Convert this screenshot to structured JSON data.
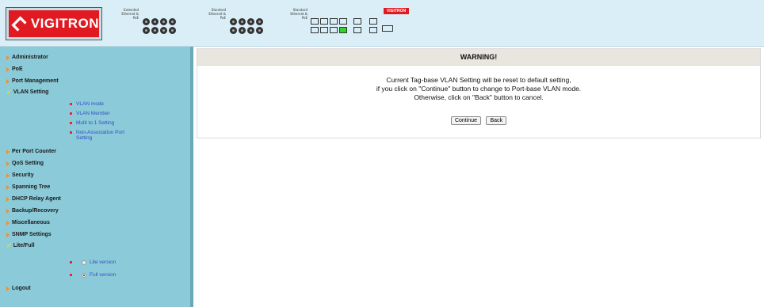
{
  "header": {
    "logo_text": "VIGITRON",
    "brand_mini": "VIGITRON",
    "panel_labels": [
      "Extended Ethernet & PoE",
      "Standard Ethernet & PoE",
      "Standard Ethernet & PoE"
    ]
  },
  "sidebar": {
    "items": [
      {
        "label": "Administrator"
      },
      {
        "label": "PoE"
      },
      {
        "label": "Port Management"
      },
      {
        "label": "VLAN Setting"
      },
      {
        "label": "Per Port Counter"
      },
      {
        "label": "QoS Setting"
      },
      {
        "label": "Security"
      },
      {
        "label": "Spanning Tree"
      },
      {
        "label": "DHCP Relay Agent"
      },
      {
        "label": "Backup/Recovery"
      },
      {
        "label": "Miscellaneous"
      },
      {
        "label": "SNMP Settings"
      },
      {
        "label": "Lite/Full"
      },
      {
        "label": "Logout"
      }
    ],
    "vlan_sub": [
      "VLAN mode",
      "VLAN Member",
      "Multi to 1 Setting",
      "Non-Association Port Setting"
    ],
    "lite_full": {
      "lite_label": "Lite version",
      "full_label": "Full version",
      "selected": "Full version"
    }
  },
  "main": {
    "title": "WARNING!",
    "line1": "Current Tag-base VLAN Setting will be reset to default setting,",
    "line2": "if you click on \"Continue\" button to change to Port-base VLAN mode.",
    "line3": "Otherwise, click on \"Back\" button to cancel.",
    "continue_label": "Continue",
    "back_label": "Back"
  },
  "colors": {
    "sidebar_bg": "#8bcad8",
    "header_bg": "#d9eef6",
    "accent_red": "#e11a22",
    "link": "#3350c4"
  }
}
